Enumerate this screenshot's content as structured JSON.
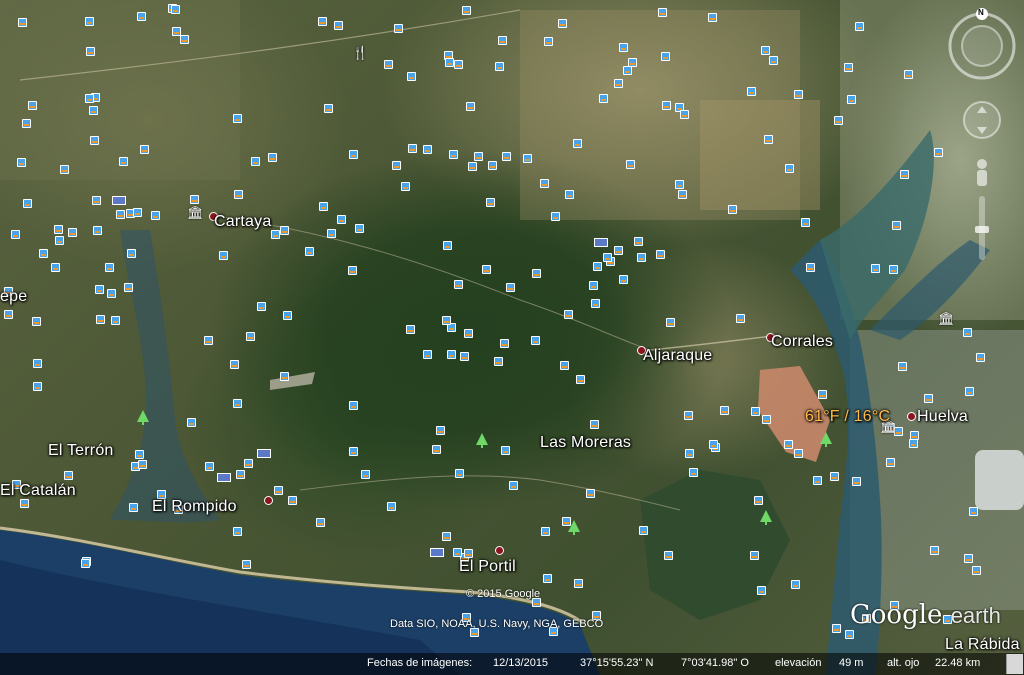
{
  "map": {
    "places": [
      {
        "name": "Cartaya",
        "kind": "town"
      },
      {
        "name": "Aljaraque",
        "kind": "town"
      },
      {
        "name": "Corrales",
        "kind": "town"
      },
      {
        "name": "Huelva",
        "kind": "city"
      },
      {
        "name": "Las Moreras",
        "kind": "locality"
      },
      {
        "name": "El Terrón",
        "kind": "locality"
      },
      {
        "name": "El Catalán",
        "kind": "locality"
      },
      {
        "name": "El Rompido",
        "kind": "town"
      },
      {
        "name": "El Portil",
        "kind": "town"
      },
      {
        "name": "La Rábida",
        "kind": "locality"
      },
      {
        "name": "epe",
        "kind": "partial"
      }
    ],
    "weather": "61°F / 16°C",
    "copyright": "© 2015 Google",
    "data_sources": "Data SIO, NOAA, U.S. Navy, NGA, GEBCO"
  },
  "status": {
    "imagery_date_label": "Fechas de imágenes:",
    "imagery_date": "12/13/2015",
    "latitude": "37°15'55.23\" N",
    "longitude": "7°03'41.98\" O",
    "elevation_label": "elevación",
    "elevation": "49 m",
    "eye_alt_label": "alt. ojo",
    "eye_alt": "22.48 km"
  },
  "branding": {
    "google": "Google",
    "earth": "earth"
  },
  "nav": {
    "north": "N"
  },
  "colors": {
    "water": "#1b3f66",
    "town_marker": "#8a1620",
    "weather_label": "#ffb94a",
    "poi": "#4aa3e8",
    "park_icon": "#6fd866"
  },
  "icons": [
    "compass-icon",
    "look-joystick-icon",
    "move-joystick-icon",
    "street-view-pegman-icon",
    "zoom-slider-icon",
    "town-marker-icon",
    "photo-poi-icon",
    "park-tree-icon",
    "museum-icon",
    "hotel-icon",
    "restaurant-icon"
  ]
}
